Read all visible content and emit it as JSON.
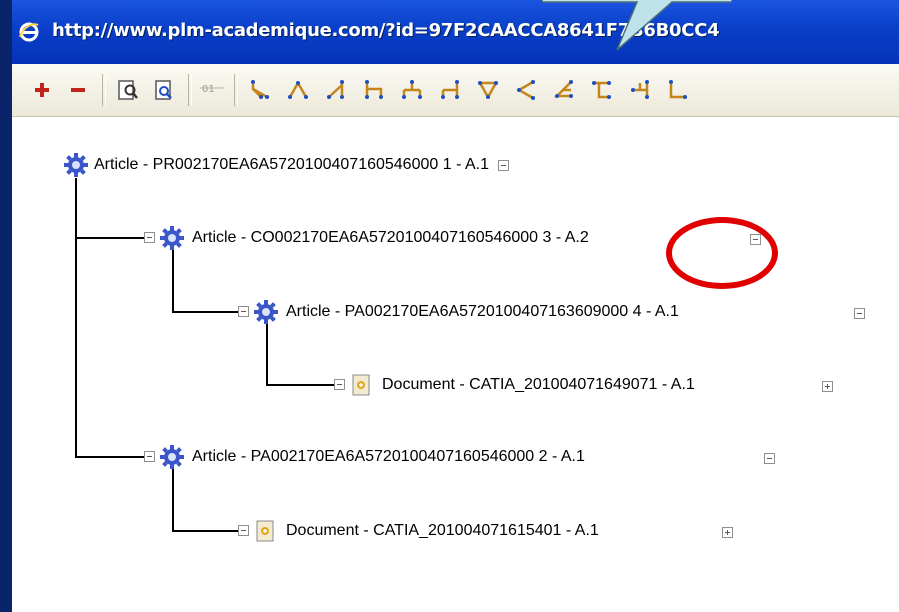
{
  "browser": {
    "url": "http://www.plm-academique.com/?id=97F2CAACCA8641F7B6B0CC4"
  },
  "toolbar": {
    "buttons": [
      {
        "name": "add-icon"
      },
      {
        "name": "remove-icon"
      },
      {
        "name": "zoom-search-icon"
      },
      {
        "name": "print-preview-icon"
      },
      {
        "name": "binary-icon",
        "label": "01"
      },
      {
        "name": "tree-layout-1-icon"
      },
      {
        "name": "tree-layout-2-icon"
      },
      {
        "name": "tree-layout-3-icon"
      },
      {
        "name": "tree-layout-4-icon"
      },
      {
        "name": "tree-layout-5-icon"
      },
      {
        "name": "tree-layout-6-icon"
      },
      {
        "name": "tree-layout-7-icon"
      },
      {
        "name": "tree-layout-8-icon"
      },
      {
        "name": "tree-layout-9-icon"
      },
      {
        "name": "tree-layout-10-icon"
      },
      {
        "name": "tree-layout-11-icon"
      }
    ]
  },
  "tree": {
    "nodes": [
      {
        "label": "Article - PR002170EA6A5720100407160546000 1 - A.1",
        "type": "article",
        "expanded": true
      },
      {
        "label": "Article - CO002170EA6A5720100407160546000 3 - A.2",
        "type": "article",
        "expanded": true
      },
      {
        "label": "Article - PA002170EA6A5720100407163609000 4 - A.1",
        "type": "article",
        "expanded": true
      },
      {
        "label": "Document - CATIA_201004071649071 - A.1",
        "type": "document",
        "expanded": false
      },
      {
        "label": "Article - PA002170EA6A5720100407160546000 2 - A.1",
        "type": "article",
        "expanded": true
      },
      {
        "label": "Document - CATIA_201004071615401 - A.1",
        "type": "document",
        "expanded": false
      }
    ]
  },
  "colors": {
    "titlebar": "#0a3fc8",
    "highlight_circle": "#e00000",
    "callout": "#bfe3ea"
  }
}
